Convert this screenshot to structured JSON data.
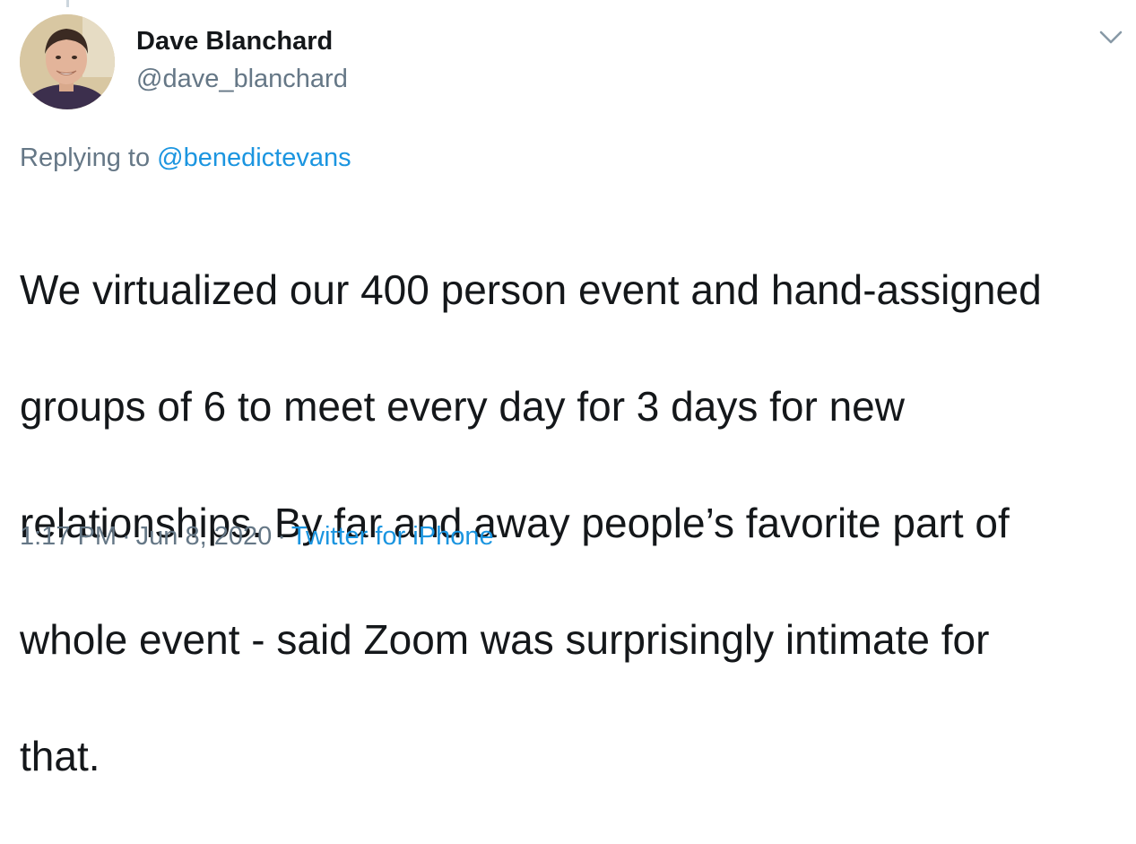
{
  "author": {
    "name": "Dave Blanchard",
    "handle": "@dave_blanchard",
    "avatar_icon": "profile-photo"
  },
  "menu_icon": "chevron-down-icon",
  "reply": {
    "prefix": "Replying to",
    "mention": "@benedictevans"
  },
  "tweet": {
    "lines": [
      "We virtualized our 400 person event and hand-assigned",
      "groups of 6 to meet every day for 3 days for new",
      "relationships. By far and away people’s favorite part of",
      "whole event - said Zoom was surprisingly intimate for",
      "that."
    ]
  },
  "meta": {
    "time": "1:17 PM",
    "separator": "·",
    "date": "Jun 8, 2020",
    "source": "Twitter for iPhone"
  },
  "colors": {
    "text": "#14171a",
    "secondary": "#657786",
    "link": "#1b95e0"
  }
}
